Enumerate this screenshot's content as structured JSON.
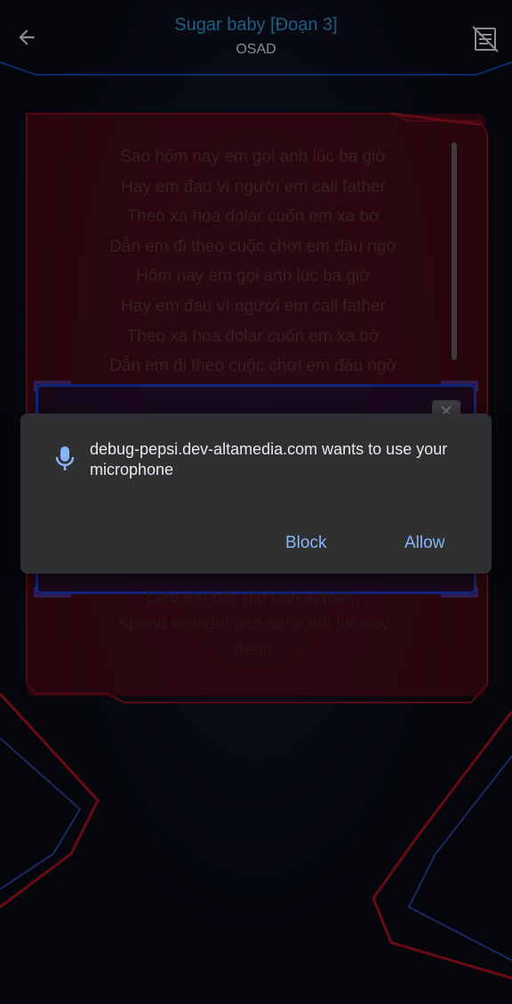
{
  "header": {
    "title": "Sugar baby [Đoạn 3]",
    "artist": "OSAD",
    "back_icon": "arrow-left-icon",
    "lyrics_toggle_icon": "lyrics-off-icon"
  },
  "lyrics": {
    "lines": [
      "Sao hôm nay em gọi anh lúc ba giờ",
      "Hay em đau vì người em call father",
      "Theo xa hoa dolar cuốn em xa bờ",
      "Dẫn em đi theo cuộc chơi em đâu ngờ",
      "Hôm nay em gọi anh lúc ba giờ",
      "Hay em đau vì người em call father",
      "Theo xa hoa dolar cuốn em xa bờ",
      "Dẫn em đi theo cuộc chơi em đâu ngờ"
    ],
    "lower_lines": [
      "Liệu em bây giờ cần ai thêm",
      "Spend all night bên cạnh em lúc say",
      "mèm"
    ]
  },
  "dialog": {
    "icon": "microphone-icon",
    "message": "debug-pepsi.dev-altamedia.com wants to use your microphone",
    "block_label": "Block",
    "allow_label": "Allow"
  },
  "colors": {
    "title": "#1f5f86",
    "dialog_bg": "#2f3032",
    "dialog_button": "#8ab4f8",
    "accent_red": "#c4121e",
    "accent_blue": "#1a3aa8"
  }
}
